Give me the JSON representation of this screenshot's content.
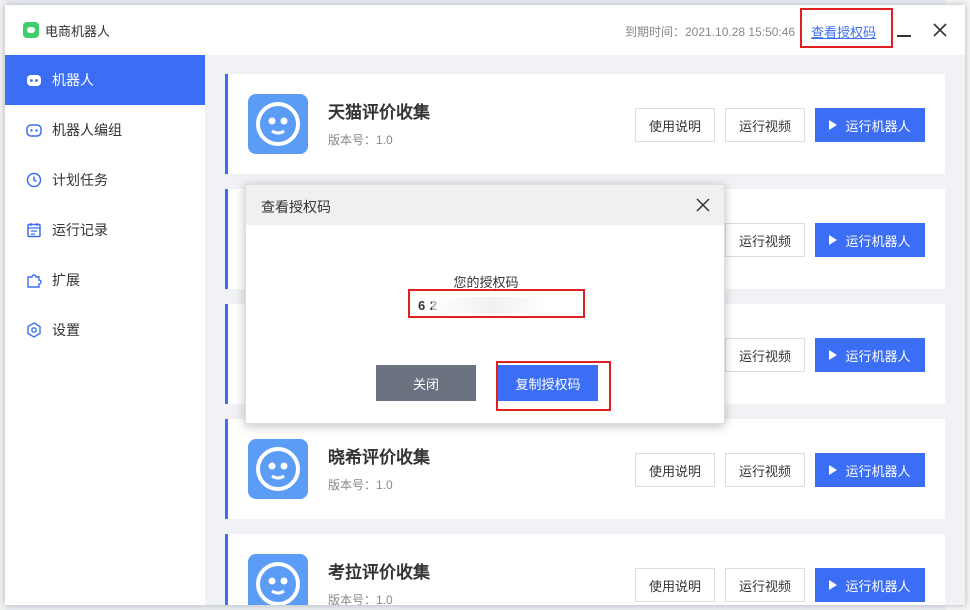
{
  "app": {
    "title": "电商机器人",
    "expire_text": "到期时间：2021.10.28 15:50:46",
    "auth_link": "查看授权码"
  },
  "sidebar": {
    "items": [
      {
        "label": "机器人",
        "icon": "robot-icon",
        "active": true
      },
      {
        "label": "机器人编组",
        "icon": "robot-group-icon"
      },
      {
        "label": "计划任务",
        "icon": "clock-icon"
      },
      {
        "label": "运行记录",
        "icon": "calendar-icon"
      },
      {
        "label": "扩展",
        "icon": "puzzle-icon"
      },
      {
        "label": "设置",
        "icon": "gear-icon"
      }
    ]
  },
  "cards": [
    {
      "title": "天猫评价收集",
      "version": "版本号：1.0"
    },
    {
      "title": "",
      "version": ""
    },
    {
      "title": "",
      "version": ""
    },
    {
      "title": "晓希评价收集",
      "version": "版本号：1.0"
    },
    {
      "title": "考拉评价收集",
      "version": "版本号：1.0"
    }
  ],
  "buttons": {
    "guide": "使用说明",
    "video": "运行视频",
    "run": "运行机器人"
  },
  "modal": {
    "title": "查看授权码",
    "code_label": "您的授权码",
    "code_value": "6                   2",
    "close_label": "关闭",
    "copy_label": "复制授权码"
  },
  "colors": {
    "accent": "#3b6ef5",
    "highlight": "#e02020",
    "close_button": "#6b7280"
  }
}
